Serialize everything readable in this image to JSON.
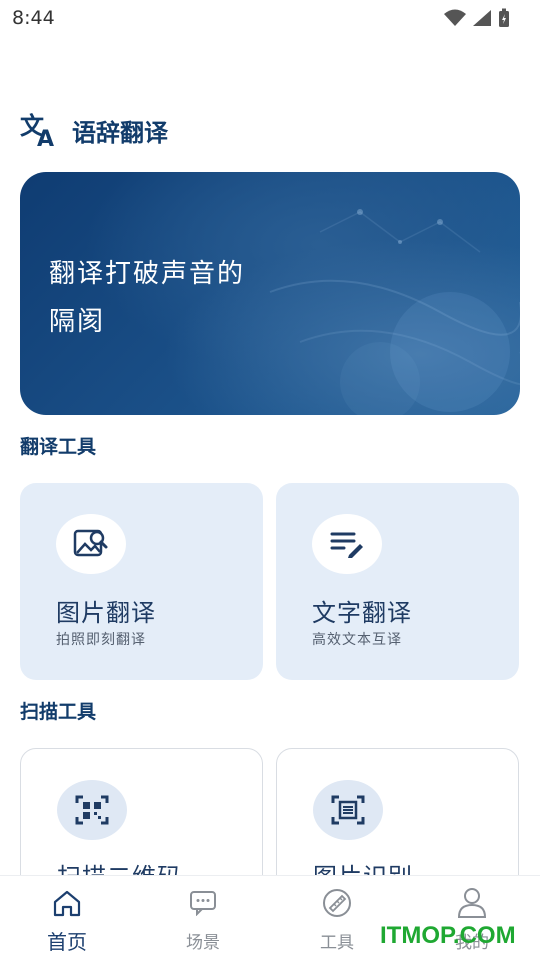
{
  "status": {
    "time": "8:44"
  },
  "app": {
    "title": "语辞翻译"
  },
  "banner": {
    "line1": "翻译打破声音的",
    "line2": "隔阂"
  },
  "sections": {
    "translate_tools": "翻译工具",
    "scan_tools": "扫描工具"
  },
  "cards": {
    "image_translate": {
      "title": "图片翻译",
      "subtitle": "拍照即刻翻译",
      "icon": "image-search-icon"
    },
    "text_translate": {
      "title": "文字翻译",
      "subtitle": "高效文本互译",
      "icon": "text-edit-icon"
    },
    "scan_qr": {
      "title": "扫描二维码",
      "icon": "qr-scan-icon"
    },
    "image_ocr": {
      "title": "图片识别",
      "icon": "ocr-scan-icon"
    }
  },
  "nav": [
    {
      "label": "首页",
      "icon": "home-icon",
      "active": true
    },
    {
      "label": "场景",
      "icon": "chat-icon",
      "active": false
    },
    {
      "label": "工具",
      "icon": "ruler-icon",
      "active": false
    },
    {
      "label": "我的",
      "icon": "user-icon",
      "active": false
    }
  ],
  "watermark": "ITMOP.COM",
  "colors": {
    "primary": "#123c6b",
    "card_bg": "#e4edf8",
    "watermark": "#1fa832"
  }
}
